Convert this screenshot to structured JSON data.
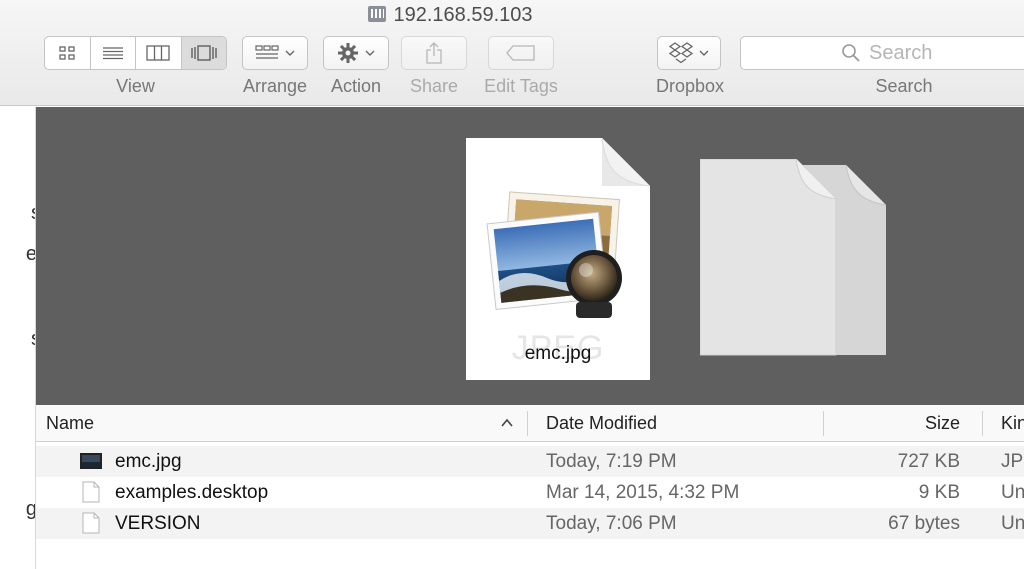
{
  "window": {
    "title": "192.168.59.103"
  },
  "toolbar": {
    "view_label": "View",
    "arrange_label": "Arrange",
    "action_label": "Action",
    "share_label": "Share",
    "edit_tags_label": "Edit Tags",
    "dropbox_label": "Dropbox",
    "search_label": "Search",
    "search_placeholder": "Search"
  },
  "sidebar": {
    "fragments": [
      "s",
      "e",
      "s",
      ".",
      "g"
    ]
  },
  "preview": {
    "file_name": "emc.jpg",
    "watermark": "JPEG"
  },
  "list": {
    "columns": {
      "name": "Name",
      "date": "Date Modified",
      "size": "Size",
      "kind": "Kin"
    },
    "rows": [
      {
        "name": "emc.jpg",
        "date": "Today, 7:19 PM",
        "size": "727 KB",
        "kind": "JP",
        "icon": "image-thumbnail-icon"
      },
      {
        "name": "examples.desktop",
        "date": "Mar 14, 2015, 4:32 PM",
        "size": "9 KB",
        "kind": "Un",
        "icon": "document-icon"
      },
      {
        "name": "VERSION",
        "date": "Today, 7:06 PM",
        "size": "67 bytes",
        "kind": "Un",
        "icon": "document-icon"
      }
    ]
  },
  "colors": {
    "preview_bg": "#5f5f5f",
    "toolbar_bg": "#ececec",
    "row_alt": "#f3f3f3"
  }
}
